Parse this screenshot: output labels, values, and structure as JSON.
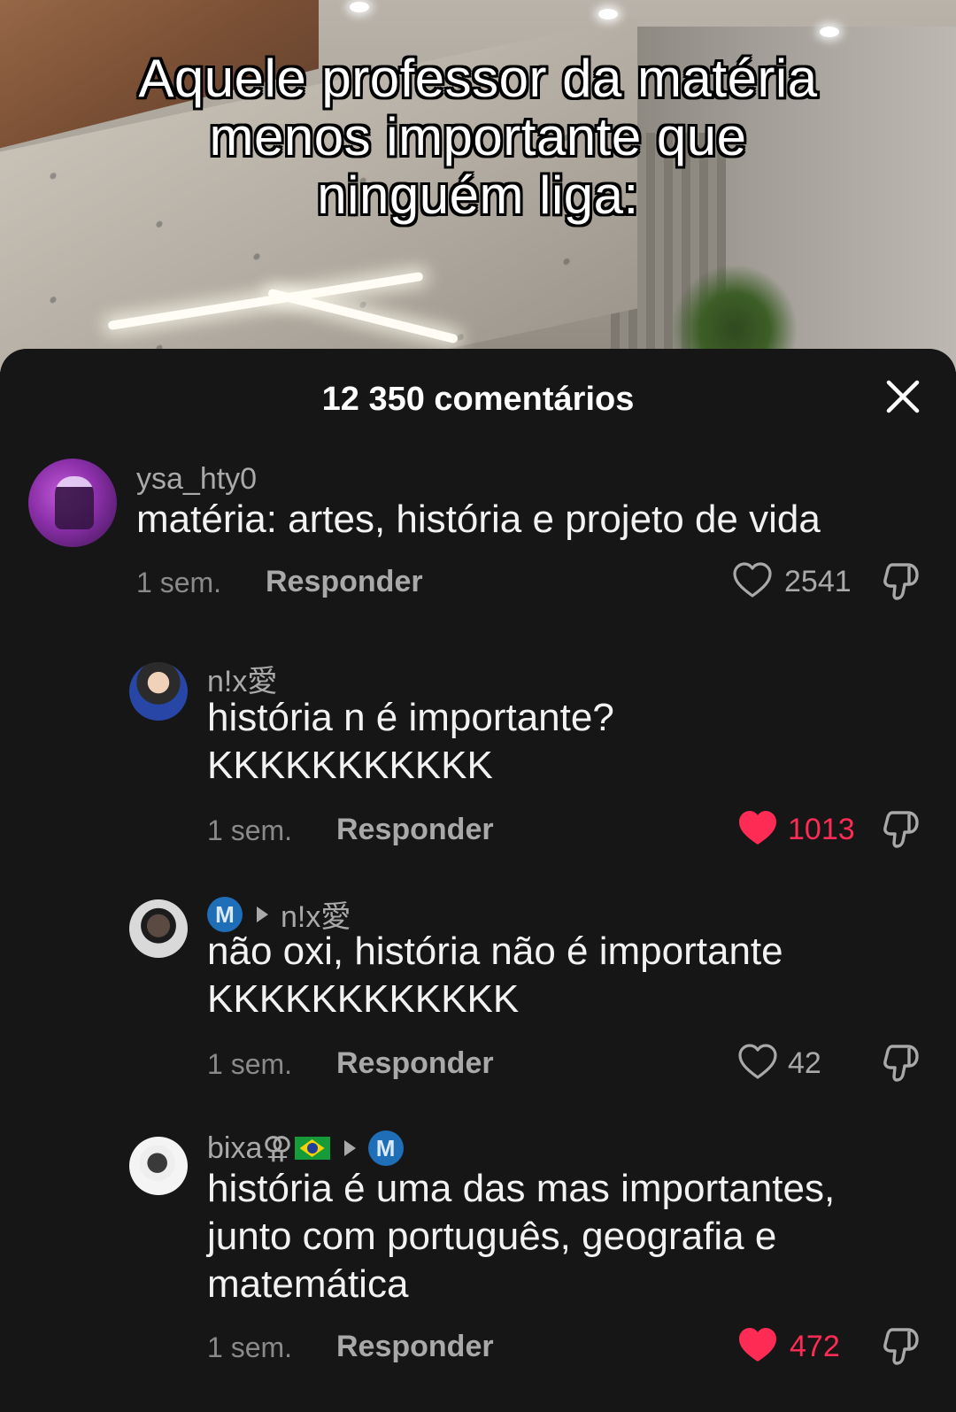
{
  "video": {
    "caption_lines": [
      "Aquele professor da matéria",
      "menos importante que",
      "ninguém liga:"
    ]
  },
  "sheet": {
    "title": "12 350 comentários",
    "close_icon": "close-icon"
  },
  "comments": [
    {
      "username": "ysa_hty0",
      "text": "matéria: artes, história e projeto de vida",
      "time": "1 sem.",
      "reply_label": "Responder",
      "likes": "2541",
      "liked": false
    },
    {
      "username": "n!x愛",
      "text_lines": [
        "história n é importante?",
        "KKKKKKKKKKK"
      ],
      "time": "1 sem.",
      "reply_label": "Responder",
      "likes": "1013",
      "liked": true
    },
    {
      "username_badge": "M",
      "reply_to": "n!x愛",
      "text_lines": [
        "não oxi, história não é importante",
        "KKKKKKKKKKKK"
      ],
      "time": "1 sem.",
      "reply_label": "Responder",
      "likes": "42",
      "liked": false
    },
    {
      "username": "bixa⚢",
      "reply_to_badge": "M",
      "text_lines": [
        "história é uma das mas importantes,",
        "junto com português, geografia e",
        "matemática"
      ],
      "time": "1 sem.",
      "reply_label": "Responder",
      "likes": "472",
      "liked": true
    }
  ],
  "colors": {
    "background": "#161616",
    "liked": "#fe2c55",
    "muted": "#a9a9a9",
    "badge": "#1e6fb8"
  }
}
